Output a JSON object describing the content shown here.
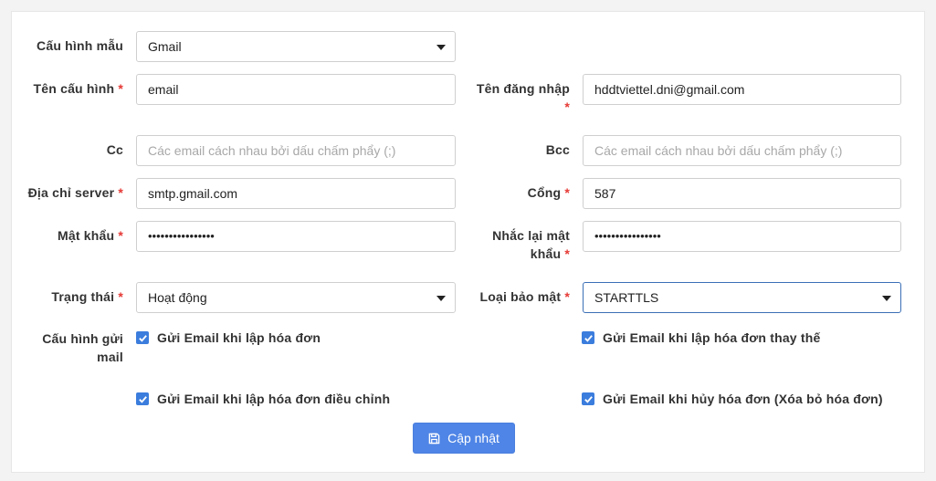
{
  "form": {
    "template": {
      "label": "Cấu hình mẫu",
      "value": "Gmail"
    },
    "config_name": {
      "label": "Tên cấu hình",
      "required": "*",
      "value": "email"
    },
    "username": {
      "label": "Tên đăng nhập",
      "required": "*",
      "value": "hddtviettel.dni@gmail.com"
    },
    "cc": {
      "label": "Cc",
      "placeholder": "Các email cách nhau bởi dấu chấm phẩy (;)"
    },
    "bcc": {
      "label": "Bcc",
      "placeholder": "Các email cách nhau bởi dấu chấm phẩy (;)"
    },
    "server": {
      "label": "Địa chỉ server",
      "required": "*",
      "value": "smtp.gmail.com"
    },
    "port": {
      "label": "Cổng",
      "required": "*",
      "value": "587"
    },
    "password": {
      "label": "Mật khẩu",
      "required": "*",
      "value": "••••••••••••••••"
    },
    "password_confirm": {
      "label_line1": "Nhắc lại mật",
      "label_line2": "khẩu",
      "required": "*",
      "value": "••••••••••••••••"
    },
    "status": {
      "label": "Trạng thái",
      "required": "*",
      "value": "Hoạt động"
    },
    "security": {
      "label": "Loại bảo mật",
      "required": "*",
      "value": "STARTTLS"
    },
    "send_config": {
      "label_line1": "Cấu hình gửi",
      "label_line2": "mail",
      "options": [
        {
          "label": "Gửi Email khi lập hóa đơn",
          "checked": true
        },
        {
          "label": "Gửi Email khi lập hóa đơn thay thế",
          "checked": true
        },
        {
          "label": "Gửi Email khi lập hóa đơn điều chỉnh",
          "checked": true
        },
        {
          "label": "Gửi Email khi hủy hóa đơn (Xóa bỏ hóa đơn)",
          "checked": true
        }
      ]
    },
    "submit_label": "Cập nhật"
  }
}
